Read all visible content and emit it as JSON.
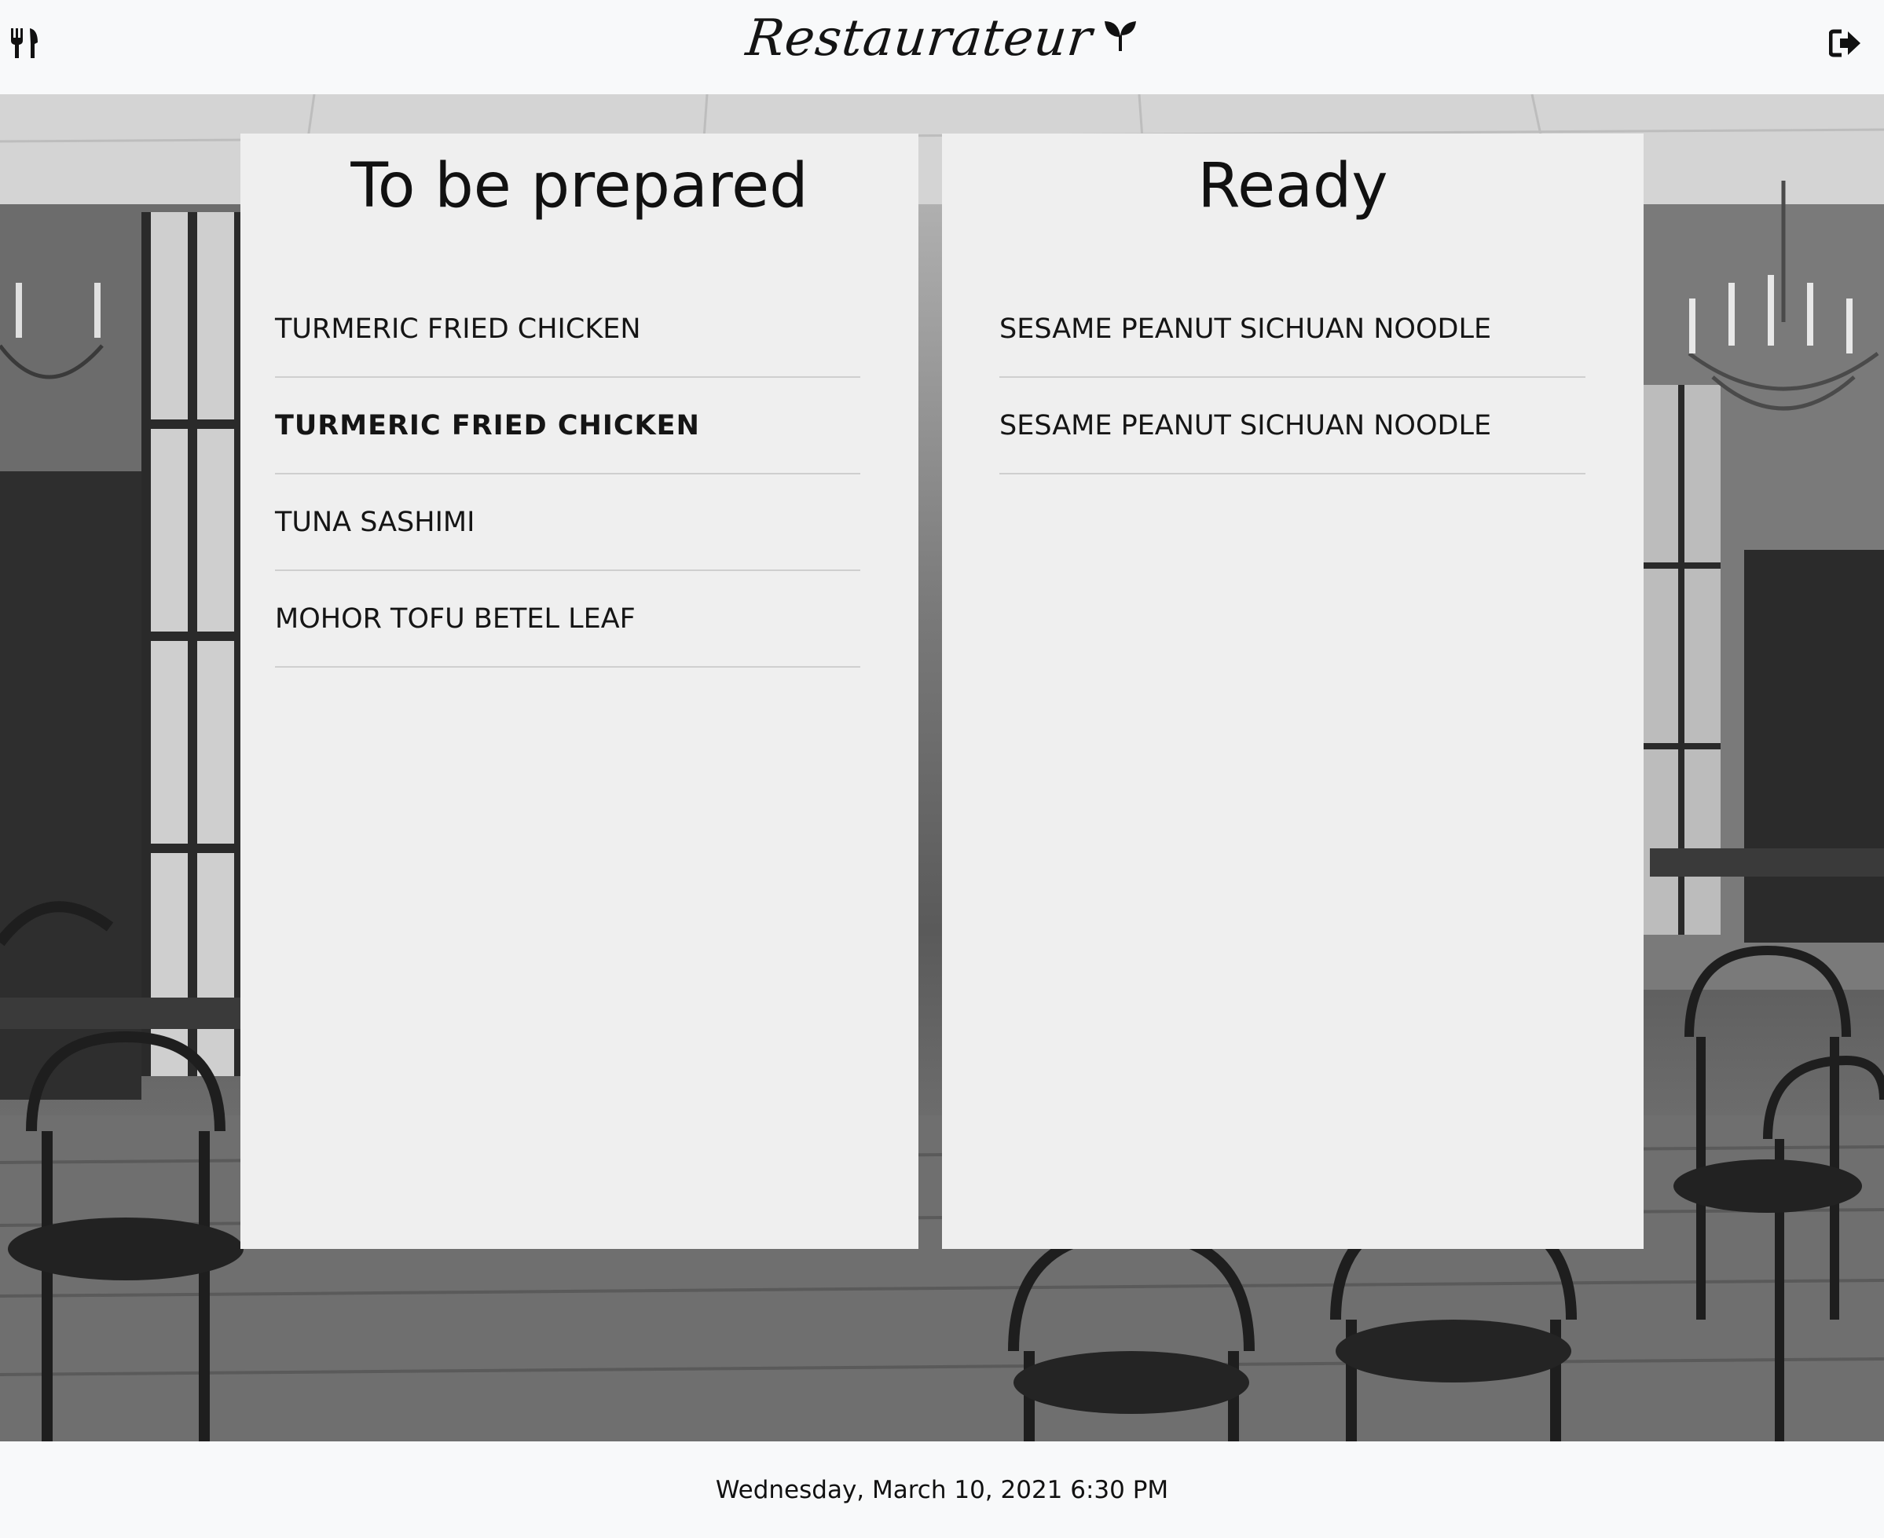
{
  "header": {
    "brand_name": "Restaurateur",
    "menu_icon": "utensils-icon",
    "brand_icon": "seedling-icon",
    "logout_icon": "sign-out-icon"
  },
  "columns": {
    "to_prepare": {
      "title": "To be prepared",
      "items": [
        {
          "label": "TURMERIC FRIED CHICKEN"
        },
        {
          "label": "TURMERIC FRIED CHICKEN"
        },
        {
          "label": "TUNA SASHIMI"
        },
        {
          "label": "MOHOR TOFU BETEL LEAF"
        }
      ]
    },
    "ready": {
      "title": "Ready",
      "items": [
        {
          "label": "SESAME PEANUT SICHUAN NOODLE"
        },
        {
          "label": "SESAME PEANUT SICHUAN NOODLE"
        }
      ]
    }
  },
  "footer": {
    "datetime": "Wednesday, March 10, 2021 6:30 PM"
  },
  "colors": {
    "bar_background": "#f8f9fa",
    "panel_background": "#efefef",
    "divider": "#cfcfcf",
    "text": "#111111"
  }
}
